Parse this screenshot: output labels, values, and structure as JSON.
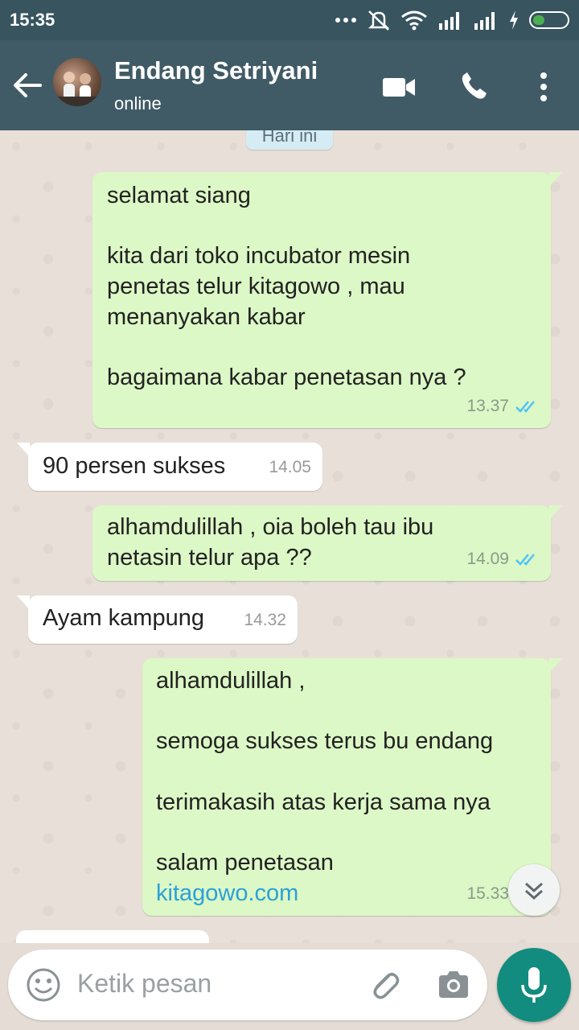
{
  "statusbar": {
    "time": "15:35"
  },
  "header": {
    "contact_name": "Endang Setriyani",
    "contact_status": "online"
  },
  "chat": {
    "date_label": "Hari ini",
    "messages": [
      {
        "direction": "out",
        "text": "selamat siang\n\nkita dari toko incubator mesin\npenetas telur kitagowo , mau\nmenanyakan kabar\n\nbagaimana kabar penetasan nya ?",
        "time": "13.37",
        "status": "read"
      },
      {
        "direction": "in",
        "text": "90 persen sukses",
        "time": "14.05"
      },
      {
        "direction": "out",
        "text": "alhamdulillah , oia boleh tau ibu\nnetasin telur apa ??",
        "time": "14.09",
        "status": "read"
      },
      {
        "direction": "in",
        "text": "Ayam kampung",
        "time": "14.32"
      },
      {
        "direction": "out",
        "text": "alhamdulillah ,\n\nsemoga sukses terus bu endang\n\nterimakasih atas kerja sama nya\n\nsalam penetasan",
        "link": "kitagowo.com",
        "time": "15.33",
        "status": "read"
      }
    ]
  },
  "input": {
    "placeholder": "Ketik pesan"
  },
  "colors": {
    "header": "#415b66",
    "statusbar": "#37545f",
    "outgoing_bubble": "#dcf8c6",
    "incoming_bubble": "#ffffff",
    "mic_button": "#128c7e",
    "read_ticks": "#4fc3f7",
    "link": "#2aa1d8"
  },
  "icons": [
    "back-arrow-icon",
    "video-call-icon",
    "phone-icon",
    "more-vert-icon",
    "emoji-icon",
    "attach-icon",
    "camera-icon",
    "mic-icon",
    "chevron-double-down-icon",
    "double-check-icon",
    "wifi-icon",
    "signal-icon",
    "battery-icon",
    "mute-icon"
  ]
}
